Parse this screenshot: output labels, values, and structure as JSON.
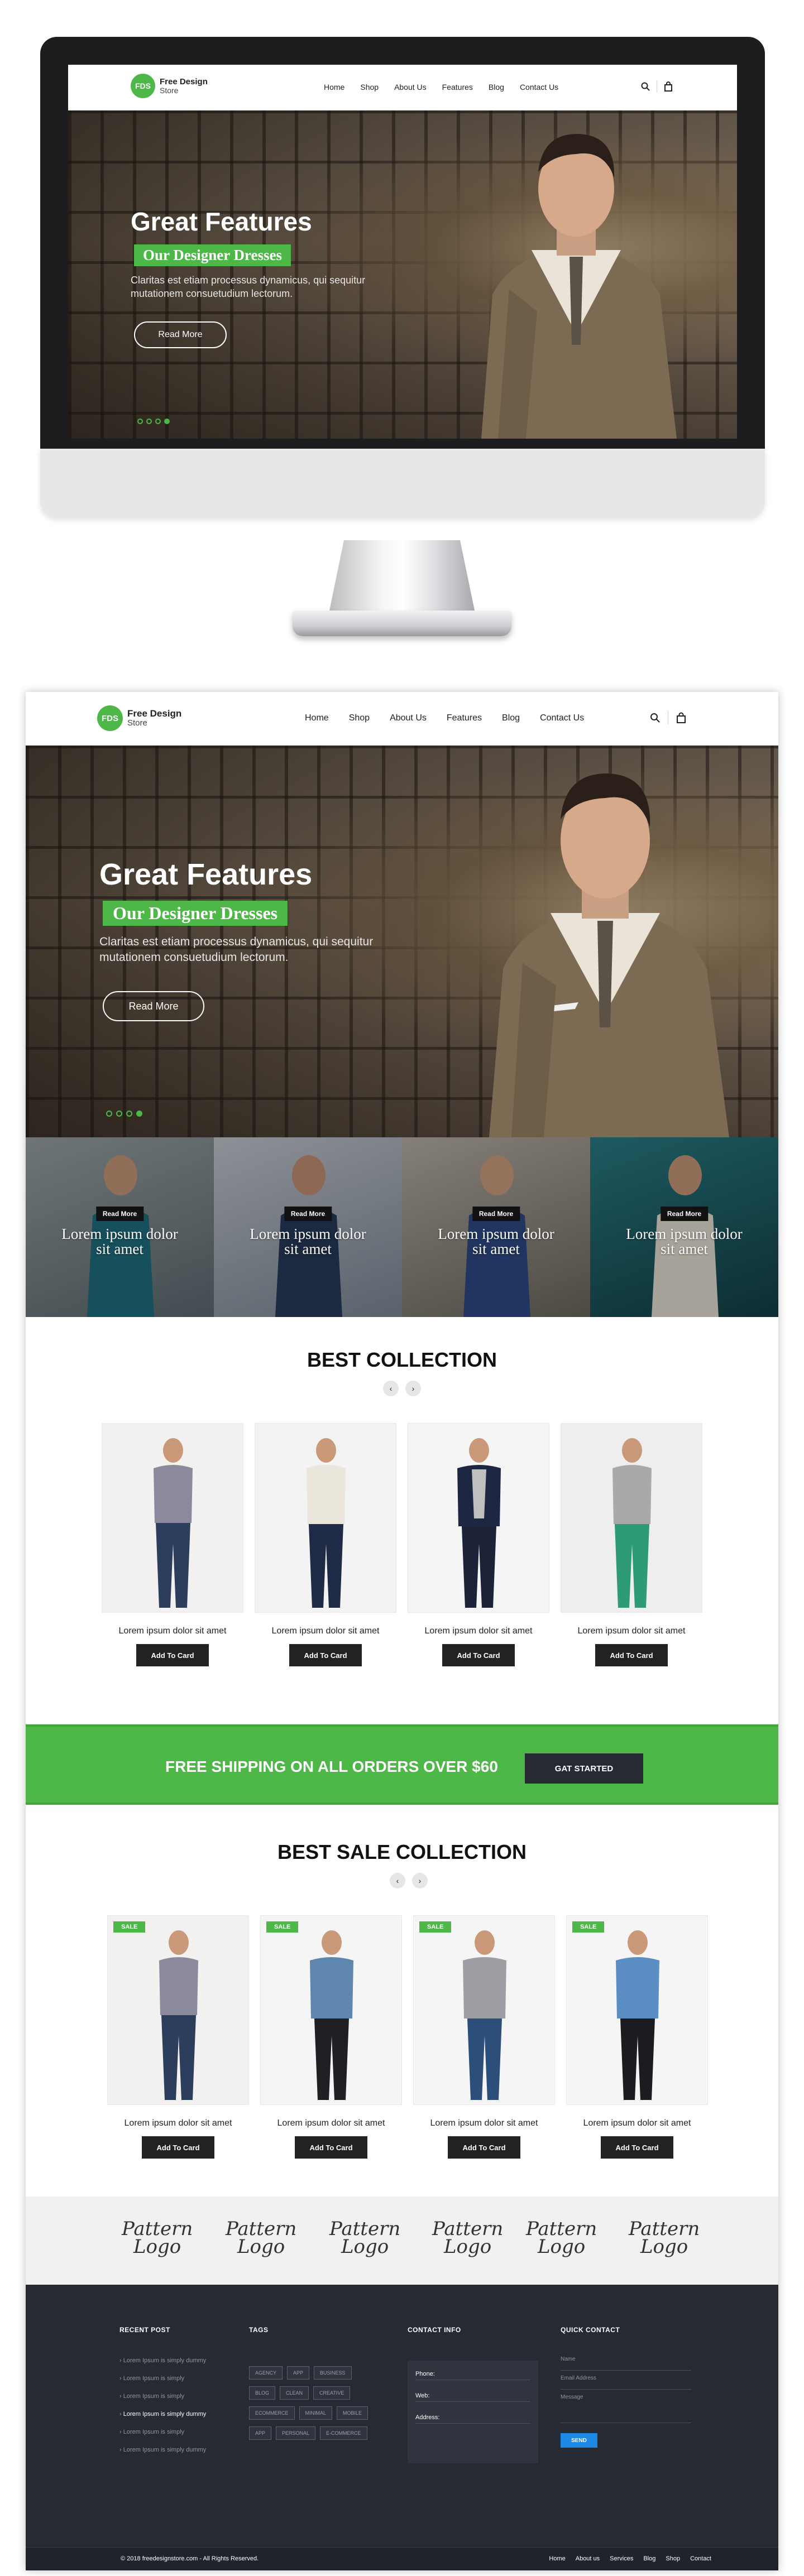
{
  "brand": {
    "badge": "FDS",
    "name": "Free Design",
    "sub": "Store"
  },
  "nav": [
    "Home",
    "Shop",
    "About Us",
    "Features",
    "Blog",
    "Contact Us"
  ],
  "icons": {
    "search": "search-icon",
    "cart": "bag-icon"
  },
  "hero": {
    "title": "Great Features",
    "subtitle": "Our Designer Dresses",
    "text_line1": "Claritas est etiam processus dynamicus, qui sequitur",
    "text_line2": "mutationem consuetudium lectorum.",
    "button": "Read More",
    "slides": 4,
    "active_slide": 4
  },
  "categories": [
    {
      "button": "Read More",
      "line1": "Lorem ipsum dolor",
      "line2": "sit amet"
    },
    {
      "button": "Read More",
      "line1": "Lorem ipsum dolor",
      "line2": "sit amet"
    },
    {
      "button": "Read More",
      "line1": "Lorem ipsum dolor",
      "line2": "sit amet"
    },
    {
      "button": "Read More",
      "line1": "Lorem ipsum dolor",
      "line2": "sit amet"
    }
  ],
  "best_collection": {
    "title": "BEST COLLECTION",
    "prev": "‹",
    "next": "›",
    "products": [
      {
        "name": "Lorem ipsum dolor sit amet",
        "button": "Add To Card"
      },
      {
        "name": "Lorem ipsum dolor sit amet",
        "button": "Add To Card"
      },
      {
        "name": "Lorem ipsum dolor sit amet",
        "button": "Add To Card"
      },
      {
        "name": "Lorem ipsum dolor sit amet",
        "button": "Add To Card"
      }
    ]
  },
  "shipping": {
    "text": "FREE SHIPPING ON ALL ORDERS OVER $60",
    "button": "GAT STARTED"
  },
  "best_sale": {
    "title": "BEST SALE COLLECTION",
    "prev": "‹",
    "next": "›",
    "badge": "SALE",
    "products": [
      {
        "name": "Lorem ipsum dolor sit amet",
        "button": "Add To Card"
      },
      {
        "name": "Lorem ipsum dolor sit amet",
        "button": "Add To Card"
      },
      {
        "name": "Lorem ipsum dolor sit amet",
        "button": "Add To Card"
      },
      {
        "name": "Lorem ipsum dolor sit amet",
        "button": "Add To Card"
      }
    ]
  },
  "brands": [
    {
      "line1": "Pattern",
      "line2": "Logo"
    },
    {
      "line1": "Pattern",
      "line2": "Logo"
    },
    {
      "line1": "Pattern",
      "line2": "Logo"
    },
    {
      "line1": "Pattern",
      "line2": "Logo"
    },
    {
      "line1": "Pattern",
      "line2": "Logo"
    },
    {
      "line1": "Pattern",
      "line2": "Logo"
    }
  ],
  "footer": {
    "recent_post": {
      "title": "RECENT POST",
      "items": [
        "Lorem Ipsum is simply dummy",
        "Lorem Ipsum is simply",
        "Lorem Ipsum is simply",
        "Lorem Ipsum is simply dummy",
        "Lorem Ipsum is simply",
        "Lorem Ipsum is simply dummy"
      ]
    },
    "tags": {
      "title": "TAGS",
      "items": [
        "AGENCY",
        "APP",
        "BUSINESS",
        "BLOG",
        "CLEAN",
        "CREATIVE",
        "ECOMMERCE",
        "MINIMAL",
        "MOBILE",
        "APP",
        "PERSONAL",
        "E-COMMERCE"
      ]
    },
    "contact": {
      "title": "CONTACT INFO",
      "phone": "Phone:",
      "web": "Web:",
      "address": "Address:"
    },
    "quick": {
      "title": "QUICK CONTACT",
      "name": "Name",
      "email": "Email Address",
      "message": "Message",
      "button": "SEND"
    },
    "copyright": "© 2018 freedesignstore.com - All Rights Reserved.",
    "links": [
      "Home",
      "About us",
      "Services",
      "Blog",
      "Shop",
      "Contact"
    ]
  },
  "colors": {
    "accent": "#4db848",
    "dark": "#262a33",
    "send": "#1e88e5"
  }
}
